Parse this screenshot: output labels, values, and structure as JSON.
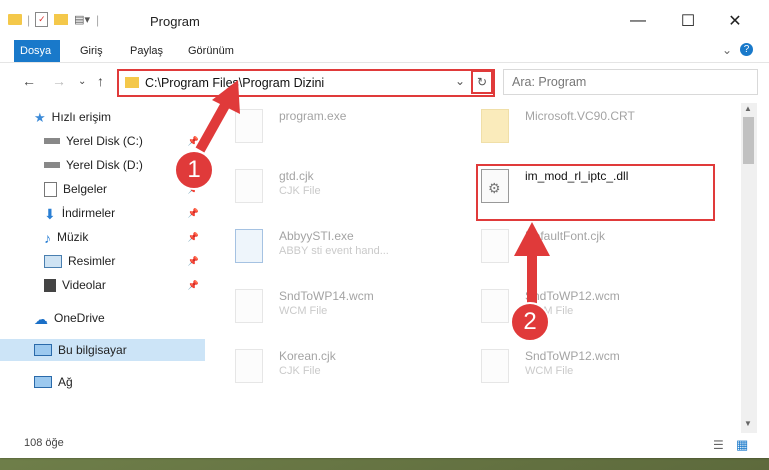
{
  "window": {
    "title": "Program"
  },
  "ribbon": {
    "tabs": [
      "Dosya",
      "Giriş",
      "Paylaş",
      "Görünüm"
    ]
  },
  "address": {
    "path": "C:\\Program Files\\Program Dizini"
  },
  "search": {
    "placeholder": "Ara: Program"
  },
  "sidebar": {
    "items": [
      {
        "label": "Hızlı erişim"
      },
      {
        "label": "Yerel Disk (C:)"
      },
      {
        "label": "Yerel Disk (D:)"
      },
      {
        "label": "Belgeler"
      },
      {
        "label": "İndirmeler"
      },
      {
        "label": "Müzik"
      },
      {
        "label": "Resimler"
      },
      {
        "label": "Videolar"
      },
      {
        "label": "OneDrive"
      },
      {
        "label": "Bu bilgisayar"
      },
      {
        "label": "Ağ"
      }
    ]
  },
  "files": [
    {
      "name": "program.exe",
      "type": ""
    },
    {
      "name": "Microsoft.VC90.CRT",
      "type": ""
    },
    {
      "name": "gtd.cjk",
      "type": "CJK File"
    },
    {
      "name": "im_mod_rl_iptc_.dll",
      "type": ""
    },
    {
      "name": "AbbyySTI.exe",
      "type": "ABBY sti event hand..."
    },
    {
      "name": "DefaultFont.cjk",
      "type": ""
    },
    {
      "name": "SndToWP14.wcm",
      "type": "WCM File"
    },
    {
      "name": "SndToWP12.wcm",
      "type": "WCM File"
    },
    {
      "name": "Korean.cjk",
      "type": "CJK File"
    },
    {
      "name": "SndToWP12.wcm",
      "type": "WCM File"
    }
  ],
  "annotations": {
    "step1": "1",
    "step2": "2"
  },
  "status": {
    "count": "108 öğe"
  },
  "colors": {
    "accent": "#1979ca",
    "highlight": "#e03a3a"
  }
}
